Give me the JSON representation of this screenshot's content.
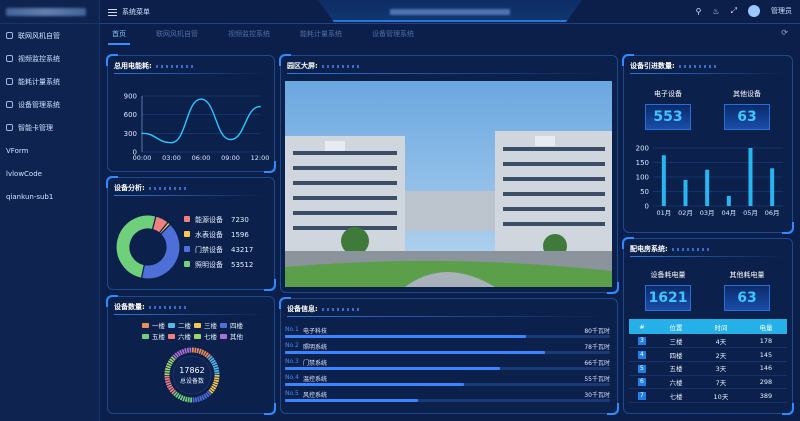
{
  "sidebar": {
    "items": [
      {
        "label": "联网风机自管"
      },
      {
        "label": "视频监控系统"
      },
      {
        "label": "能耗计量系统"
      },
      {
        "label": "设备管理系统"
      },
      {
        "label": "智能卡管理"
      },
      {
        "label": "VForm"
      },
      {
        "label": "lvlowCode"
      },
      {
        "label": "qiankun-sub1"
      }
    ]
  },
  "topbar": {
    "menu_label": "系统菜单",
    "user": "管理员"
  },
  "tabs": [
    {
      "label": "首页",
      "active": true
    },
    {
      "label": "联网风机自管"
    },
    {
      "label": "视频监控系统"
    },
    {
      "label": "能耗计量系统"
    },
    {
      "label": "设备管理系统"
    }
  ],
  "panels": {
    "power": {
      "title": "总用电能耗:"
    },
    "analysis": {
      "title": "设备分析:"
    },
    "quantity": {
      "title": "设备数量:"
    },
    "campus": {
      "title": "园区大屏:"
    },
    "info": {
      "title": "设备信息:"
    },
    "access": {
      "title": "设备引进数量:"
    },
    "distribution": {
      "title": "配电房系统:"
    }
  },
  "colors": {
    "accent": "#2f8bff",
    "cyan": "#3fc5ff",
    "line": "#2ec6ff"
  },
  "chart_data": [
    {
      "type": "line",
      "title": "总用电能耗:",
      "x": [
        "00:00",
        "03:00",
        "06:00",
        "09:00",
        "12:00"
      ],
      "values": [
        300,
        150,
        850,
        200,
        730
      ],
      "yticks": [
        0,
        300,
        600,
        900
      ],
      "ylim": [
        0,
        900
      ]
    },
    {
      "type": "pie",
      "title": "设备分析:",
      "labels": [
        "能源设备",
        "水表设备",
        "门禁设备",
        "照明设备"
      ],
      "values": [
        7230,
        1596,
        43217,
        53512
      ],
      "colors": [
        "#f07f7f",
        "#f5c94f",
        "#4f6fd8",
        "#6fcf7a"
      ]
    },
    {
      "type": "pie",
      "title": "设备数量:",
      "labels": [
        "一楼",
        "二楼",
        "三楼",
        "四楼",
        "五楼",
        "六楼",
        "七楼",
        "其他"
      ],
      "colors": [
        "#f08c5a",
        "#57b9e8",
        "#f5c94f",
        "#4f6fd8",
        "#6fcf7a",
        "#f07f7f",
        "#9fd36a",
        "#b06fd8"
      ],
      "center_value": "17862",
      "center_label": "总设备数"
    },
    {
      "type": "bar",
      "title": "设备引进数量:",
      "categories": [
        "01月",
        "02月",
        "03月",
        "04月",
        "05月",
        "06月"
      ],
      "values": [
        175,
        90,
        125,
        35,
        200,
        130
      ],
      "yticks": [
        0,
        50,
        100,
        150,
        200
      ],
      "ylim": [
        0,
        200
      ]
    }
  ],
  "access": {
    "electronic_label": "电子设备",
    "electronic_value": "553",
    "other_label": "其他设备",
    "other_value": "63"
  },
  "distribution": {
    "equipment_label": "设备耗电量",
    "equipment_value": "1621",
    "other_label": "其他耗电量",
    "other_value": "63",
    "headers": [
      "#",
      "位置",
      "时间",
      "电量"
    ],
    "rows": [
      {
        "idx": "3",
        "loc": "三楼",
        "time": "4天",
        "power": "178"
      },
      {
        "idx": "4",
        "loc": "四楼",
        "time": "2天",
        "power": "145"
      },
      {
        "idx": "5",
        "loc": "五楼",
        "time": "3天",
        "power": "146"
      },
      {
        "idx": "6",
        "loc": "六楼",
        "time": "7天",
        "power": "298"
      },
      {
        "idx": "7",
        "loc": "七楼",
        "time": "10天",
        "power": "389"
      }
    ]
  },
  "info": {
    "rows": [
      {
        "no": "No.1",
        "name": "电子科技",
        "amount": "80千瓦时",
        "pct": 0.74
      },
      {
        "no": "No.2",
        "name": "照明系统",
        "amount": "78千瓦时",
        "pct": 0.8
      },
      {
        "no": "No.3",
        "name": "门禁系统",
        "amount": "66千瓦时",
        "pct": 0.66
      },
      {
        "no": "No.4",
        "name": "温控系统",
        "amount": "55千瓦时",
        "pct": 0.55
      },
      {
        "no": "No.5",
        "name": "风控系统",
        "amount": "30千瓦时",
        "pct": 0.41
      }
    ]
  }
}
